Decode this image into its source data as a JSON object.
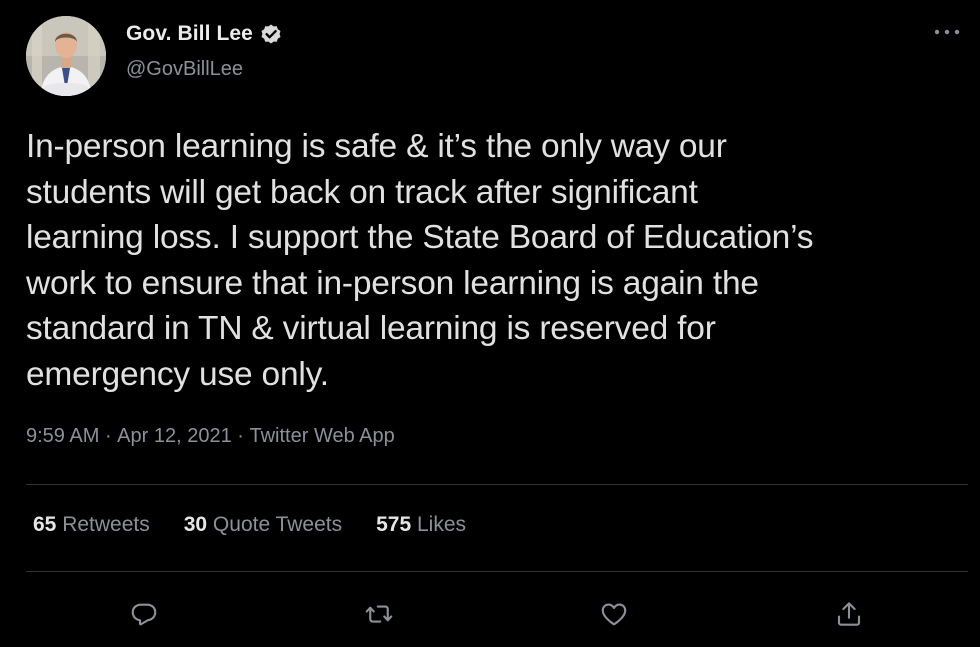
{
  "author": {
    "name": "Gov. Bill Lee",
    "handle": "@GovBillLee",
    "verified_icon": "verified-badge-icon"
  },
  "tweet": {
    "text": "In-person learning is safe & it’s the only way our\nstudents will get back on track after significant\nlearning loss. I support the State Board of Education’s\nwork to ensure that in-person learning is again the\nstandard in TN & virtual learning is reserved for\nemergency use only.",
    "time": "9:59 AM",
    "separator": " · ",
    "date": "Apr 12, 2021",
    "source": "Twitter Web App"
  },
  "stats": {
    "retweets": {
      "count": "65",
      "label": " Retweets"
    },
    "quote_tweets": {
      "count": "30",
      "label": " Quote Tweets"
    },
    "likes": {
      "count": "575",
      "label": " Likes"
    }
  },
  "actions": {
    "reply": "reply-icon",
    "retweet": "retweet-icon",
    "like": "heart-icon",
    "share": "share-icon"
  },
  "colors": {
    "background": "#000000",
    "primary_text": "#e1e1e1",
    "secondary_text": "#8b9198",
    "divider": "#2f3336",
    "verified_badge": "#d9d9d9"
  }
}
